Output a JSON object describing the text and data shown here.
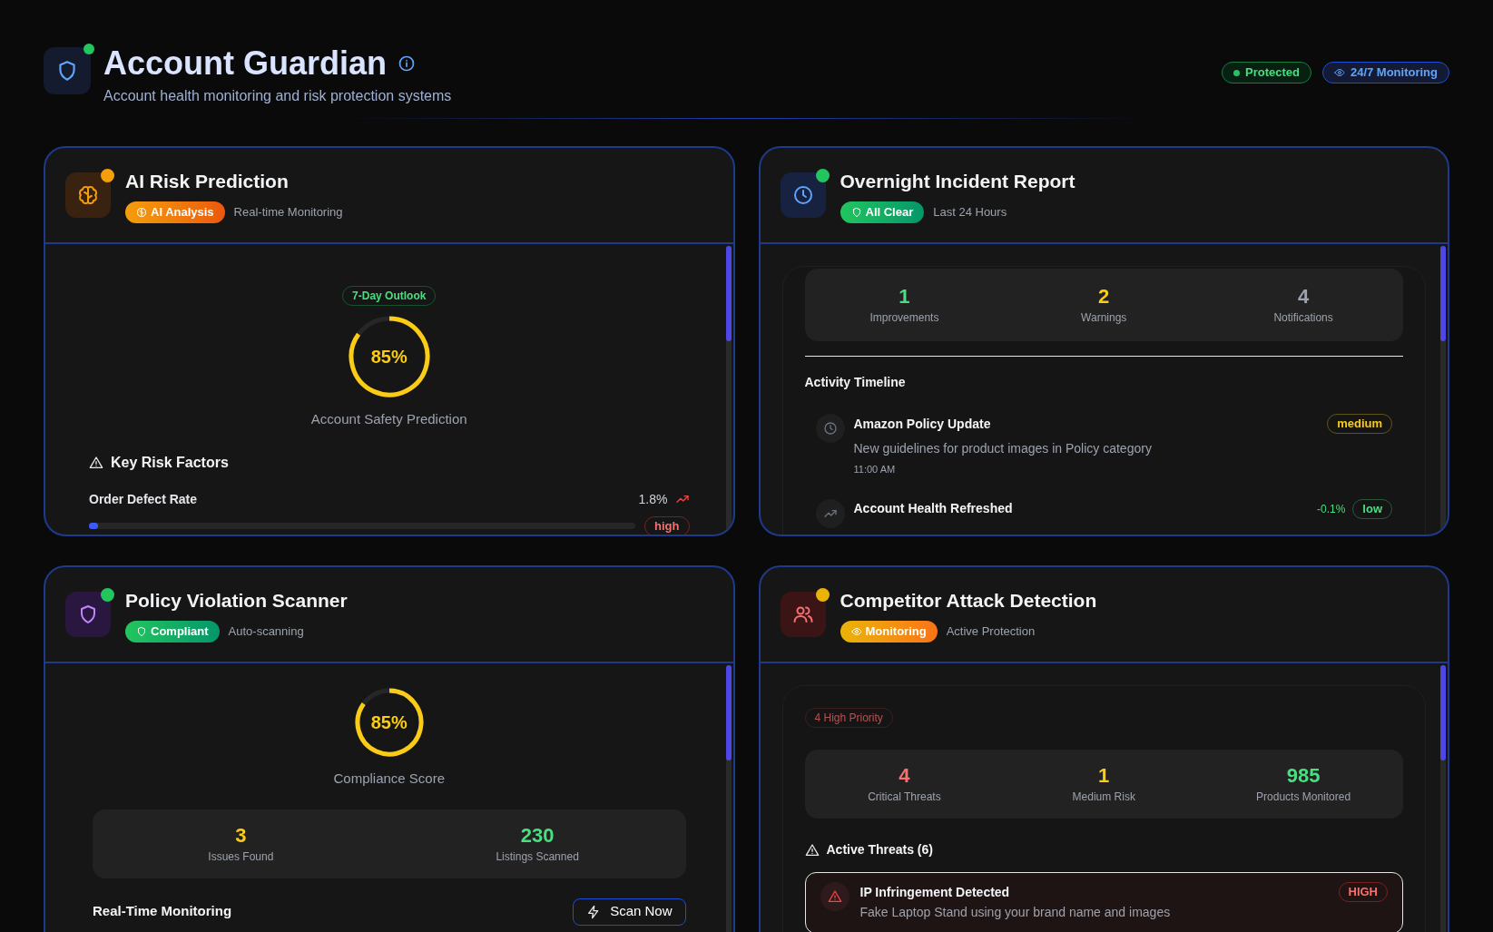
{
  "header": {
    "title": "Account Guardian",
    "subtitle": "Account health monitoring and risk protection systems",
    "live": true,
    "status_badges": [
      {
        "label": "Protected",
        "kind": "dot"
      },
      {
        "label": "24/7 Monitoring",
        "kind": "eye"
      }
    ]
  },
  "cards": [
    {
      "kind": "risk",
      "title": "AI Risk Prediction",
      "color": "#f59e0b",
      "badge": {
        "label": "AI Analysis"
      },
      "caption": "Real-time Monitoring",
      "outlook": "7-Day Outlook",
      "gauge": {
        "value": "85%",
        "level": 0.85,
        "caption": "Account Safety Prediction"
      },
      "factors_title": "Key Risk Factors",
      "factors": [
        {
          "name": "Order Defect Rate",
          "value": "1.8%",
          "level": 0.015,
          "severity": "high"
        }
      ]
    },
    {
      "kind": "incident",
      "title": "Overnight Incident Report",
      "color": "#22c55e",
      "badge": {
        "label": "All Clear"
      },
      "caption": "Last 24 Hours",
      "stats": [
        {
          "value": "1",
          "label": "Improvements",
          "color": "#4ade80"
        },
        {
          "value": "2",
          "label": "Warnings",
          "color": "#facc15"
        },
        {
          "value": "4",
          "label": "Notifications",
          "color": "#9ca3af"
        }
      ],
      "section_title": "Activity Timeline",
      "timeline": [
        {
          "title": "Amazon Policy Update",
          "description": "New guidelines for product images in Policy category",
          "time": "11:00 AM",
          "severity": "medium",
          "color": "#facc15"
        },
        {
          "title": "Account Health Refreshed",
          "change": "-0.1%",
          "severity": "low",
          "color": "#4ade80"
        }
      ]
    },
    {
      "kind": "scanner",
      "title": "Policy Violation Scanner",
      "color": "#22c55e",
      "badge": {
        "label": "Compliant"
      },
      "caption": "Auto-scanning",
      "gauge": {
        "value": "85%",
        "level": 0.85,
        "caption": "Compliance Score"
      },
      "stats": [
        {
          "value": "3",
          "label": "Issues Found",
          "color": "#facc15"
        },
        {
          "value": "230",
          "label": "Listings Scanned",
          "color": "#4ade80"
        }
      ],
      "monitor_title": "Real-Time Monitoring",
      "button": "Scan Now"
    },
    {
      "kind": "competitor",
      "title": "Competitor Attack Detection",
      "color": "#eab308",
      "badge": {
        "label": "Monitoring"
      },
      "caption": "Active Protection",
      "priority": "4 High Priority",
      "stats": [
        {
          "value": "4",
          "label": "Critical Threats",
          "color": "#f87171"
        },
        {
          "value": "1",
          "label": "Medium Risk",
          "color": "#facc15"
        },
        {
          "value": "985",
          "label": "Products Monitored",
          "color": "#4ade80"
        }
      ],
      "threats_title": "Active Threats (6)",
      "threats": [
        {
          "title": "IP Infringement Detected",
          "description": "Fake Laptop Stand using your brand name and images",
          "severity": "HIGH"
        }
      ]
    }
  ]
}
